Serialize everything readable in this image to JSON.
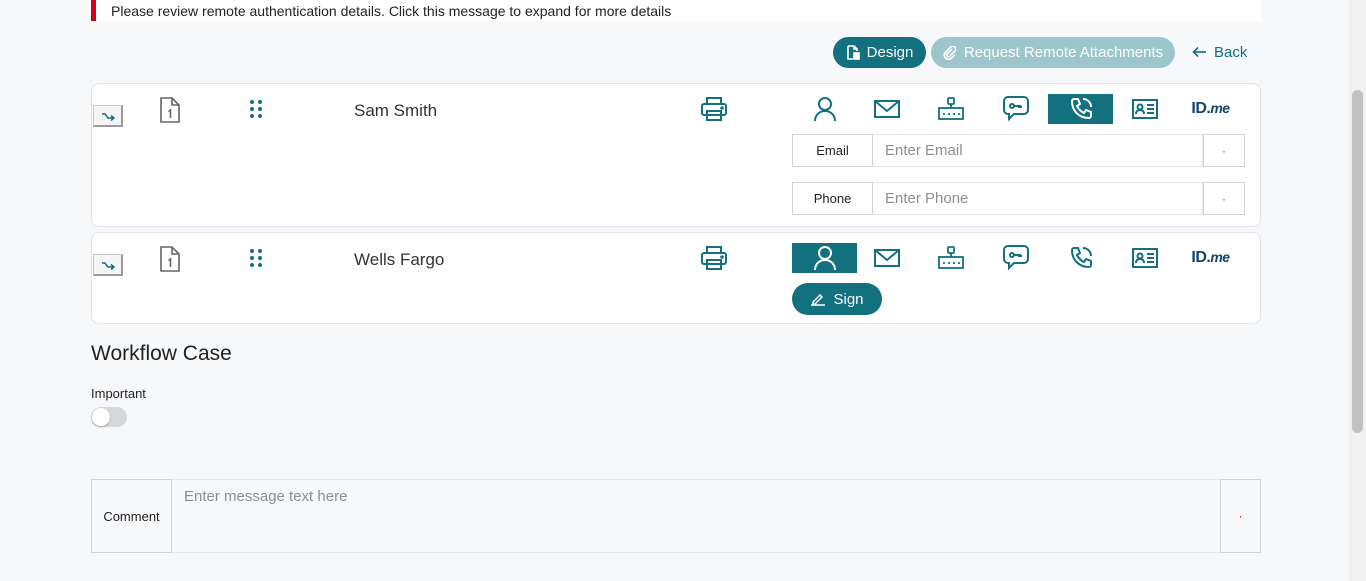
{
  "alert": {
    "message": "Please review remote authentication details. Click this message to expand for more details"
  },
  "toolbar": {
    "design_label": "Design",
    "request_label": "Request Remote Attachments",
    "back_label": "Back"
  },
  "recipients": [
    {
      "name": "Sam Smith",
      "active_auth": "phone",
      "fields": [
        {
          "label": "Email",
          "placeholder": "Enter Email"
        },
        {
          "label": "Phone",
          "placeholder": "Enter Phone"
        }
      ]
    },
    {
      "name": "Wells Fargo",
      "active_auth": "person",
      "sign_label": "Sign"
    }
  ],
  "auth_icons": [
    "person-icon",
    "mail-icon",
    "keypad-icon",
    "sms-icon",
    "phone-icon",
    "id-card-icon",
    "idme-logo"
  ],
  "idme": {
    "id": "ID.",
    "me": "me"
  },
  "workflow": {
    "title": "Workflow Case",
    "important_label": "Important",
    "important_on": false,
    "comment_label": "Comment",
    "comment_placeholder": "Enter message text here"
  },
  "required_marker": "·",
  "colors": {
    "accent": "#12707f",
    "accent_disabled": "#9cc6cc",
    "alert": "#d0021b",
    "idme": "#14456b"
  }
}
